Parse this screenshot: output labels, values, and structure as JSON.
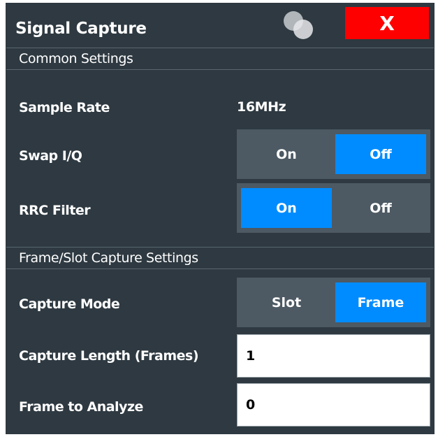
{
  "dialog": {
    "title": "Signal Capture",
    "close_label": "X"
  },
  "common_settings": {
    "header": "Common Settings",
    "sample_rate": {
      "label": "Sample Rate",
      "value": "16MHz"
    },
    "swap_iq": {
      "label": "Swap I/Q",
      "options": [
        "On",
        "Off"
      ],
      "selected": "Off"
    },
    "rrc_filter": {
      "label": "RRC Filter",
      "options": [
        "On",
        "Off"
      ],
      "selected": "On"
    }
  },
  "capture_settings": {
    "header": "Frame/Slot Capture Settings",
    "capture_mode": {
      "label": "Capture Mode",
      "options": [
        "Slot",
        "Frame"
      ],
      "selected": "Frame"
    },
    "capture_length": {
      "label": "Capture Length (Frames)",
      "value": "1"
    },
    "frame_to_analyze": {
      "label": "Frame to Analyze",
      "value": "0"
    }
  },
  "colors": {
    "background": "#2e3941",
    "toggle_bg": "#4d5963",
    "active": "#008cff",
    "close": "#ff0000"
  }
}
